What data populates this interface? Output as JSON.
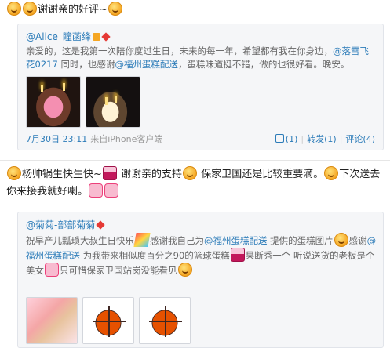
{
  "post1": {
    "text": "谢谢亲的好评~",
    "quote": {
      "author": "@Alice_瞳菡绛",
      "text_a": "亲爱的，这是我第一次陪你度过生日，未来的每一年，希望都有我在你身边，",
      "mention1": "@落雪飞花0217",
      "text_b": "同时，也感谢",
      "mention2": "@福州蛋糕配送",
      "text_c": "，蛋糕味道挺不错，做的也很好看。晚安。",
      "time": "7月30日 23:11",
      "source": "来自iPhone客户端",
      "likes": "(1)",
      "reposts": "转发(1)",
      "comments": "评论(4)"
    }
  },
  "post2": {
    "text_a": "杨帅锅生快生快~",
    "text_b": "谢谢亲的支持",
    "text_c": "保家卫国还是比较重要滴。",
    "text_d": "下次送去你来接我就好喇。",
    "quote": {
      "author": "@菊菊-部部菊菊",
      "text_a": "祝早产儿瓢琐大叔生日快乐",
      "text_b": "感谢我自己为",
      "mention1": "@福州蛋糕配送",
      "text_c": "提供的蛋糕图片",
      "text_d": "感谢",
      "mention2": "@福州蛋糕配送",
      "text_e": "为我带来相似度百分之90的篮球蛋糕",
      "text_f": "果断秀一个 听说送货的老板是个美女",
      "text_g": "只可惜保家卫国站岗没能看见"
    }
  },
  "colors": {
    "link": "#2b7bb8",
    "quote_bg": "#f5f6f8"
  }
}
